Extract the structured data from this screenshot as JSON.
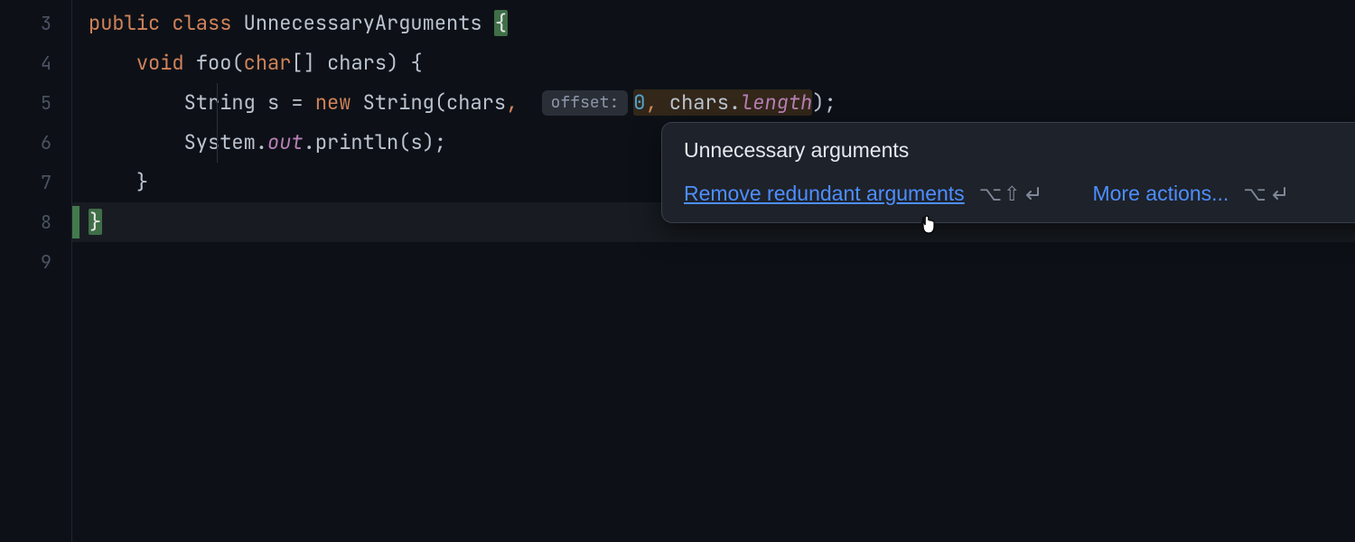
{
  "gutter": {
    "start": 3,
    "end": 9
  },
  "code": {
    "line3": {
      "k_public": "public",
      "k_class": "class",
      "classname": "UnnecessaryArguments",
      "brace": "{"
    },
    "line4": {
      "k_void": "void",
      "fn": "foo",
      "k_char": "char",
      "arr": "[]",
      "param": "chars",
      "open": "(",
      "close": ")",
      "brace": "{"
    },
    "line5": {
      "t_string": "String",
      "var": "s",
      "eq": "=",
      "k_new": "new",
      "t_string2": "String",
      "open": "(",
      "arg1": "chars",
      "comma1": ",",
      "hint": "offset:",
      "num": "0",
      "comma2": ",",
      "arg3a": "chars",
      "dot": ".",
      "arg3b": "length",
      "close": ")",
      "semi": ";"
    },
    "line6": {
      "sys": "System",
      "dot1": ".",
      "out": "out",
      "dot2": ".",
      "println": "println",
      "open": "(",
      "arg": "s",
      "close": ")",
      "semi": ";"
    },
    "line7": {
      "brace": "}"
    },
    "line8": {
      "brace": "}"
    }
  },
  "popup": {
    "title": "Unnecessary arguments",
    "fix_label": "Remove redundant arguments",
    "fix_shortcut": "⌥⇧↵",
    "more_label": "More actions...",
    "more_shortcut": "⌥↵"
  }
}
